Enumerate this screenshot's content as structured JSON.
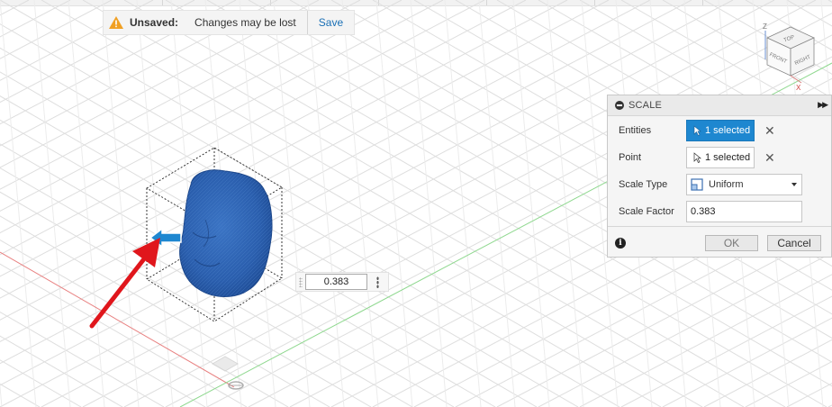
{
  "unsaved": {
    "label": "Unsaved:",
    "message": "Changes may be lost",
    "save_label": "Save"
  },
  "viewcube": {
    "faces": [
      "TOP",
      "FRONT",
      "RIGHT"
    ],
    "axes": [
      "Z",
      "X"
    ]
  },
  "scale_panel": {
    "title": "SCALE",
    "entities_label": "Entities",
    "entities_value": "1 selected",
    "point_label": "Point",
    "point_value": "1 selected",
    "scale_type_label": "Scale Type",
    "scale_type_value": "Uniform",
    "scale_factor_label": "Scale Factor",
    "scale_factor_value": "0.383",
    "ok_label": "OK",
    "cancel_label": "Cancel"
  },
  "canvas_input": {
    "value": "0.383"
  },
  "colors": {
    "accent_blue": "#1e87d0",
    "model_blue": "#2c5fae",
    "arrow_red": "#e0161c",
    "axis_green": "#4ec24e",
    "axis_red": "#e05a5a",
    "grid": "#dcdcdc"
  }
}
